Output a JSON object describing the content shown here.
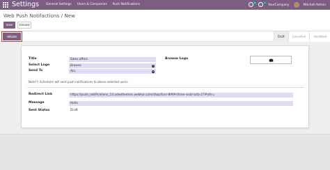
{
  "navbar": {
    "brand": "Settings",
    "menu": [
      "General Settings",
      "Users & Companies",
      "Push Notifications"
    ],
    "chat_count": "6",
    "activity_count": "1",
    "company": "YourCompany",
    "user": "Mitchell Admin",
    "icons": [
      "apps-grid-icon",
      "chat-icon",
      "activity-clock-icon",
      "avatar"
    ]
  },
  "breadcrumb": "Web Push Notifactions / New",
  "buttons": {
    "save": "Save",
    "discard": "Discard",
    "validate": "Validate"
  },
  "stages": [
    {
      "label": "Draft",
      "active": true
    },
    {
      "label": "Cancelled",
      "active": false
    },
    {
      "label": "Validated",
      "active": false
    }
  ],
  "form": {
    "title_label": "Title",
    "title_value": "Sales offers",
    "select_logo_label": "Select Logo",
    "select_logo_value": "Browse",
    "send_to_label": "Send To",
    "send_to_value": "ALL",
    "browse_logo_label": "Browse Logo",
    "note": "Note!!! Scheduler will sent push notifications to above selected users.",
    "redirect_link_label": "Redirect Link",
    "redirect_link_value": "https://push_notifications_14.odoothemes.webkul.com/shop/furn-8999-three-seat-sofa-27#attr=",
    "message_label": "Message",
    "message_value": "Hello",
    "sent_status_label": "Sent Status",
    "sent_status_value": "Draft"
  },
  "colors": {
    "brand": "#7c5e83",
    "field_bg": "#dedcf5",
    "highlight": "#d93434"
  }
}
